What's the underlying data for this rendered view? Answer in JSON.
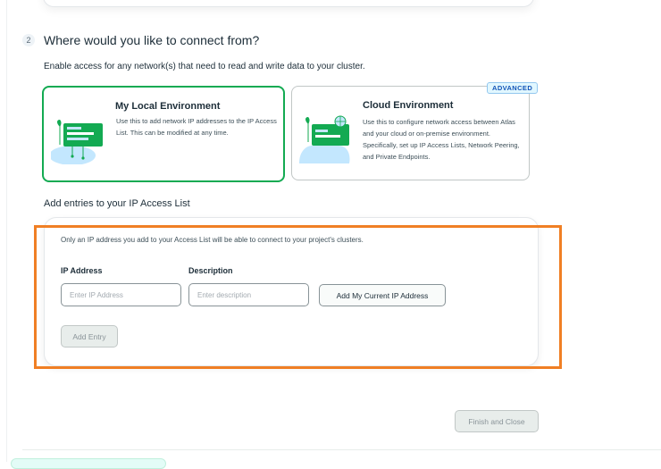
{
  "step": {
    "number": "2",
    "title": "Where would you like to connect from?",
    "description": "Enable access for any network(s) that need to read and write data to your cluster."
  },
  "environments": {
    "local": {
      "title": "My Local Environment",
      "description": "Use this to add network IP addresses to the IP Access List. This can be modified at any time.",
      "selected": true
    },
    "cloud": {
      "title": "Cloud Environment",
      "badge": "ADVANCED",
      "description": "Use this to configure network access between Atlas and your cloud or on-premise environment. Specifically, set up IP Access Lists, Network Peering, and Private Endpoints.",
      "selected": false
    }
  },
  "access_list": {
    "section_title": "Add entries to your IP Access List",
    "note": "Only an IP address you add to your Access List will be able to connect to your project's clusters.",
    "ip_label": "IP Address",
    "ip_placeholder": "Enter IP Address",
    "description_label": "Description",
    "description_placeholder": "Enter description",
    "add_current_ip_label": "Add My Current IP Address",
    "add_entry_label": "Add Entry"
  },
  "footer": {
    "finish_label": "Finish and Close"
  },
  "colors": {
    "selected_border": "#13aa52",
    "highlight": "#f07f24",
    "badge_text": "#1254b7"
  }
}
